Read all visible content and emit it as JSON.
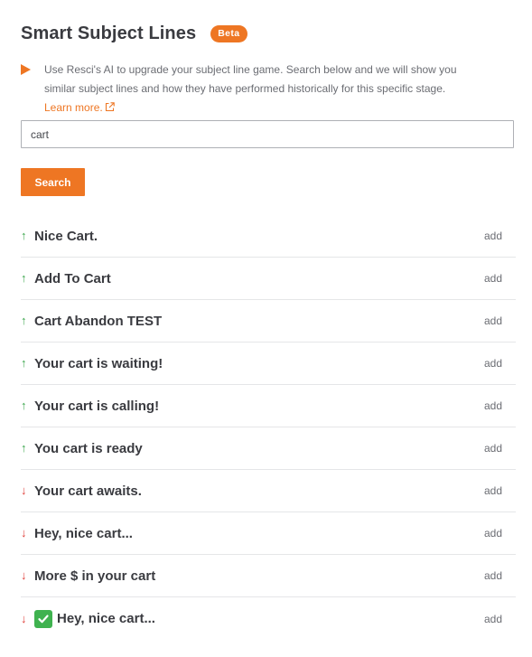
{
  "header": {
    "title": "Smart Subject Lines",
    "badge": "Beta"
  },
  "description": {
    "text": "Use Resci's AI to upgrade your subject line game. Search below and we will show you similar subject lines and how they have performed historically for this specific stage. ",
    "link_label": "Learn more."
  },
  "search": {
    "value": "cart",
    "button_label": "Search"
  },
  "results": [
    {
      "label": "Nice Cart.",
      "trend": "up",
      "add_label": "add"
    },
    {
      "label": "Add To Cart",
      "trend": "up",
      "add_label": "add"
    },
    {
      "label": "Cart Abandon TEST",
      "trend": "up",
      "add_label": "add"
    },
    {
      "label": "Your cart is waiting!",
      "trend": "up",
      "add_label": "add"
    },
    {
      "label": "Your cart is calling!",
      "trend": "up",
      "add_label": "add"
    },
    {
      "label": "You cart is ready",
      "trend": "up",
      "add_label": "add"
    },
    {
      "label": "Your cart awaits.",
      "trend": "down",
      "add_label": "add"
    },
    {
      "label": "Hey, nice cart...",
      "trend": "down",
      "add_label": "add"
    },
    {
      "label": "More $ in your cart",
      "trend": "down",
      "add_label": "add"
    },
    {
      "label": "Hey, nice cart...",
      "trend": "down",
      "emoji": "check-mark-button",
      "add_label": "add"
    }
  ],
  "colors": {
    "accent": "#ee7623",
    "trend_up": "#3aa64b",
    "trend_down": "#e0403a"
  }
}
